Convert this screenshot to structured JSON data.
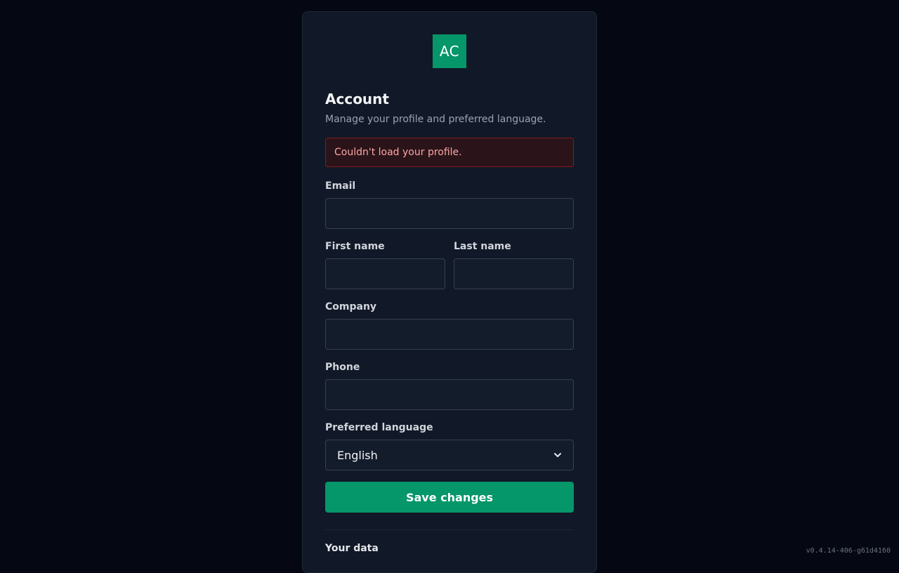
{
  "brand": {
    "logo_text": "AC",
    "accent": "#059669"
  },
  "header": {
    "title": "Account",
    "subtitle": "Manage your profile and preferred language."
  },
  "alert": {
    "message": "Couldn't load your profile.",
    "color": "#fca5a5"
  },
  "form": {
    "email": {
      "label": "Email",
      "value": "",
      "placeholder": ""
    },
    "first_name": {
      "label": "First name",
      "value": "",
      "placeholder": ""
    },
    "last_name": {
      "label": "Last name",
      "value": "",
      "placeholder": ""
    },
    "company": {
      "label": "Company",
      "value": "",
      "placeholder": ""
    },
    "phone": {
      "label": "Phone",
      "value": "",
      "placeholder": ""
    },
    "language": {
      "label": "Preferred language",
      "selected": "English"
    },
    "save_label": "Save changes"
  },
  "data_section": {
    "title": "Your data"
  },
  "footer": {
    "version": "v0.4.14-406-g61d4160"
  }
}
